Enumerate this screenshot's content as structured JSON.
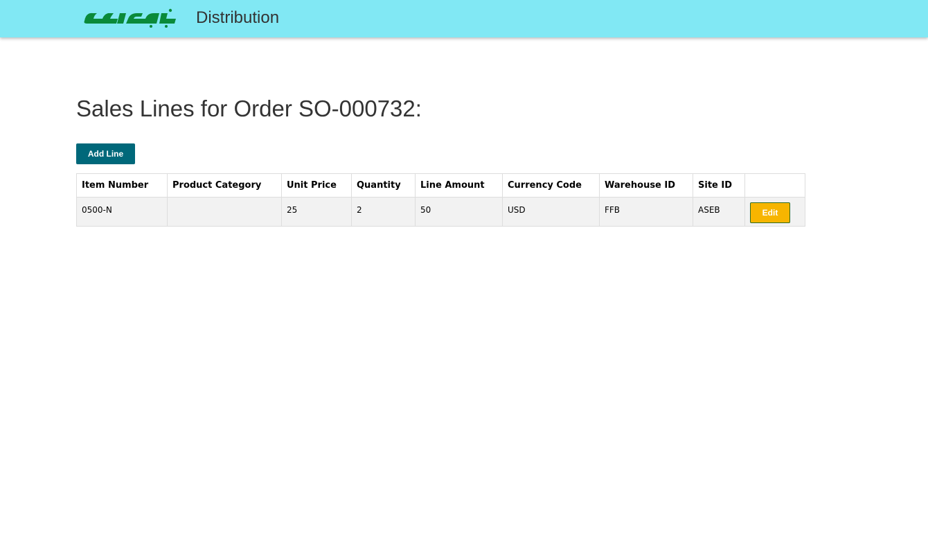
{
  "header": {
    "logo_text": "تجارتي",
    "logo_color": "#0a8a3a",
    "app_name": "Distribution",
    "background": "#81e8f4"
  },
  "page": {
    "title": "Sales Lines for Order SO-000732:",
    "add_button_label": "Add Line"
  },
  "table": {
    "columns": [
      "Item Number",
      "Product Category",
      "Unit Price",
      "Quantity",
      "Line Amount",
      "Currency Code",
      "Warehouse ID",
      "Site ID",
      ""
    ],
    "rows": [
      {
        "item_number": "0500-N",
        "product_category": "",
        "unit_price": "25",
        "quantity": "2",
        "line_amount": "50",
        "currency_code": "USD",
        "warehouse_id": "FFB",
        "site_id": "ASEB",
        "edit_label": "Edit"
      }
    ]
  }
}
